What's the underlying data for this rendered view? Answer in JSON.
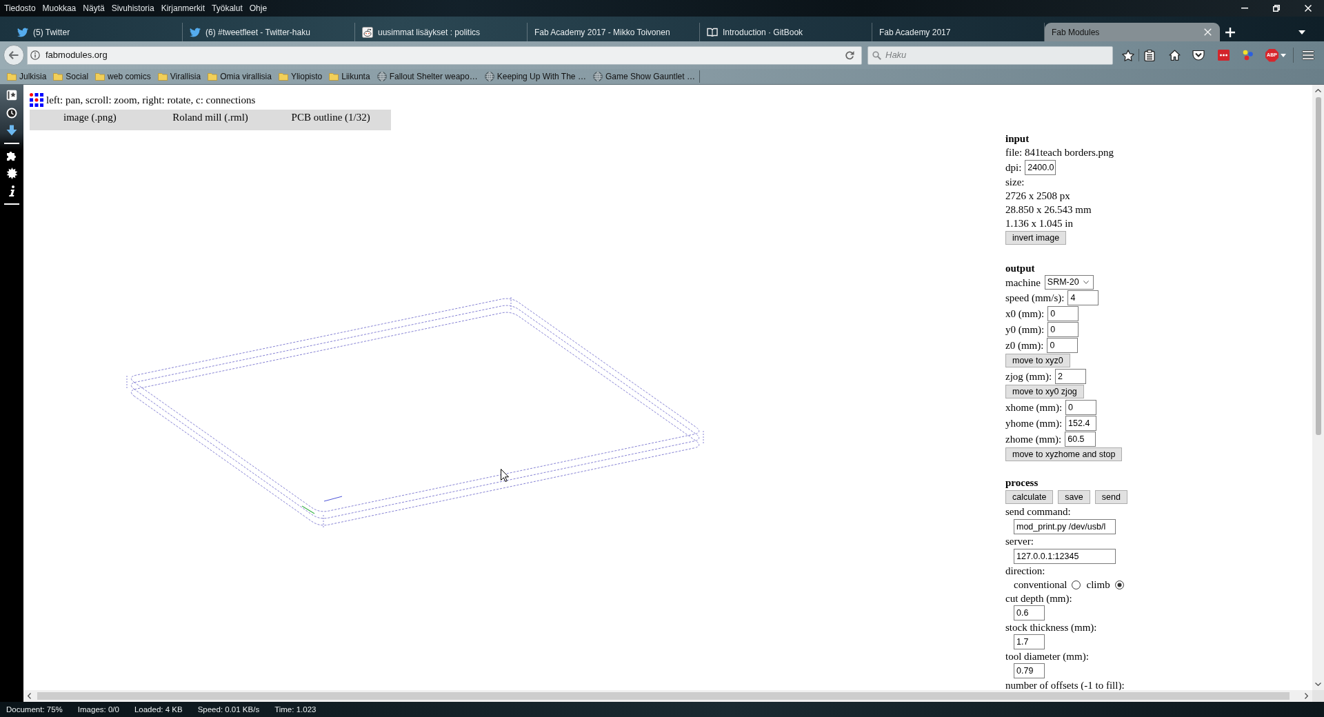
{
  "menu_bar": {
    "items": [
      "Tiedosto",
      "Muokkaa",
      "Näytä",
      "Sivuhistoria",
      "Kirjanmerkit",
      "Työkalut",
      "Ohje"
    ]
  },
  "tabs": [
    {
      "label": "(5) Twitter",
      "kind": "bird",
      "selected": false
    },
    {
      "label": "(6) #tweetfleet - Twitter-haku",
      "kind": "bird",
      "selected": false
    },
    {
      "label": "uusimmat lisäykset : politics",
      "kind": "alien",
      "selected": false
    },
    {
      "label": "Fab Academy 2017 - Mikko Toivonen",
      "kind": "plain",
      "selected": false
    },
    {
      "label": "Introduction · GitBook",
      "kind": "book",
      "selected": false
    },
    {
      "label": "Fab Academy 2017",
      "kind": "plain",
      "selected": false
    },
    {
      "label": "Fab Modules",
      "kind": "plain",
      "selected": true
    }
  ],
  "address_bar": {
    "url": "fabmodules.org"
  },
  "search_bar": {
    "placeholder": "Haku"
  },
  "toolbar": {
    "badge_text": "ABP"
  },
  "bookmarks": [
    {
      "label": "Julkisia",
      "kind": "folder"
    },
    {
      "label": "Social",
      "kind": "folder"
    },
    {
      "label": "web comics",
      "kind": "folder"
    },
    {
      "label": "Virallisia",
      "kind": "folder"
    },
    {
      "label": "Omia virallisia",
      "kind": "folder"
    },
    {
      "label": "Yliopisto",
      "kind": "folder"
    },
    {
      "label": "Liikunta",
      "kind": "folder"
    },
    {
      "label": "Fallout Shelter weapo…",
      "kind": "page"
    },
    {
      "label": "Keeping Up With The …",
      "kind": "page"
    },
    {
      "label": "Game Show Gauntlet …",
      "kind": "page"
    }
  ],
  "page": {
    "hint": "left: pan, scroll: zoom, right: rotate, c: connections",
    "modules": [
      "image (.png)",
      "Roland mill (.rml)",
      "PCB outline (1/32)"
    ]
  },
  "panel": {
    "sections": [
      {
        "title": "input",
        "items": [
          {
            "kind": "text",
            "text": "file: 841teach borders.png"
          },
          {
            "kind": "field",
            "label": "dpi:",
            "value": "2400.0"
          },
          {
            "kind": "text",
            "text": "size:"
          },
          {
            "kind": "text",
            "text": "2726 x 2508 px"
          },
          {
            "kind": "text",
            "text": "28.850 x 26.543 mm"
          },
          {
            "kind": "text",
            "text": "1.136 x 1.045 in"
          },
          {
            "kind": "button",
            "label": "invert image"
          }
        ]
      },
      {
        "title": "output",
        "items": [
          {
            "kind": "select",
            "label": "machine",
            "value": "SRM-20"
          },
          {
            "kind": "field",
            "label": "speed (mm/s):",
            "value": "4"
          },
          {
            "kind": "field",
            "label": "x0 (mm):",
            "value": "0"
          },
          {
            "kind": "field",
            "label": "y0 (mm):",
            "value": "0"
          },
          {
            "kind": "field",
            "label": "z0 (mm):",
            "value": "0"
          },
          {
            "kind": "button",
            "label": "move to xyz0"
          },
          {
            "kind": "field",
            "label": "zjog (mm):",
            "value": "2"
          },
          {
            "kind": "button",
            "label": "move to xy0 zjog"
          },
          {
            "kind": "field",
            "label": "xhome (mm):",
            "value": "0"
          },
          {
            "kind": "field",
            "label": "yhome (mm):",
            "value": "152.4"
          },
          {
            "kind": "field",
            "label": "zhome (mm):",
            "value": "60.5"
          },
          {
            "kind": "button",
            "label": "move to xyzhome and stop"
          }
        ]
      },
      {
        "title": "process",
        "items": [
          {
            "kind": "buttons",
            "labels": [
              "calculate",
              "save",
              "send"
            ]
          },
          {
            "kind": "text",
            "text": "send command:"
          },
          {
            "kind": "wide_entry",
            "value": "mod_print.py /dev/usb/l"
          },
          {
            "kind": "text",
            "text": "server:"
          },
          {
            "kind": "wide_entry",
            "value": "127.0.0.1:12345"
          },
          {
            "kind": "text",
            "text": "direction:"
          },
          {
            "kind": "radios",
            "options": [
              {
                "label": "conventional",
                "selected": false
              },
              {
                "label": "climb",
                "selected": true
              }
            ]
          },
          {
            "kind": "text",
            "text": "cut depth (mm):"
          },
          {
            "kind": "entry",
            "value": "0.6"
          },
          {
            "kind": "text",
            "text": "stock thickness (mm):"
          },
          {
            "kind": "entry",
            "value": "1.7"
          },
          {
            "kind": "text",
            "text": "tool diameter (mm):"
          },
          {
            "kind": "entry",
            "value": "0.79"
          },
          {
            "kind": "text",
            "text": "number of offsets (-1 to fill):"
          }
        ]
      }
    ]
  },
  "status_bar": {
    "items": [
      "Document: 75%",
      "Images: 0/0",
      "Loaded: 4 KB",
      "Speed: 0.01 KB/s",
      "Time: 1.023"
    ]
  }
}
